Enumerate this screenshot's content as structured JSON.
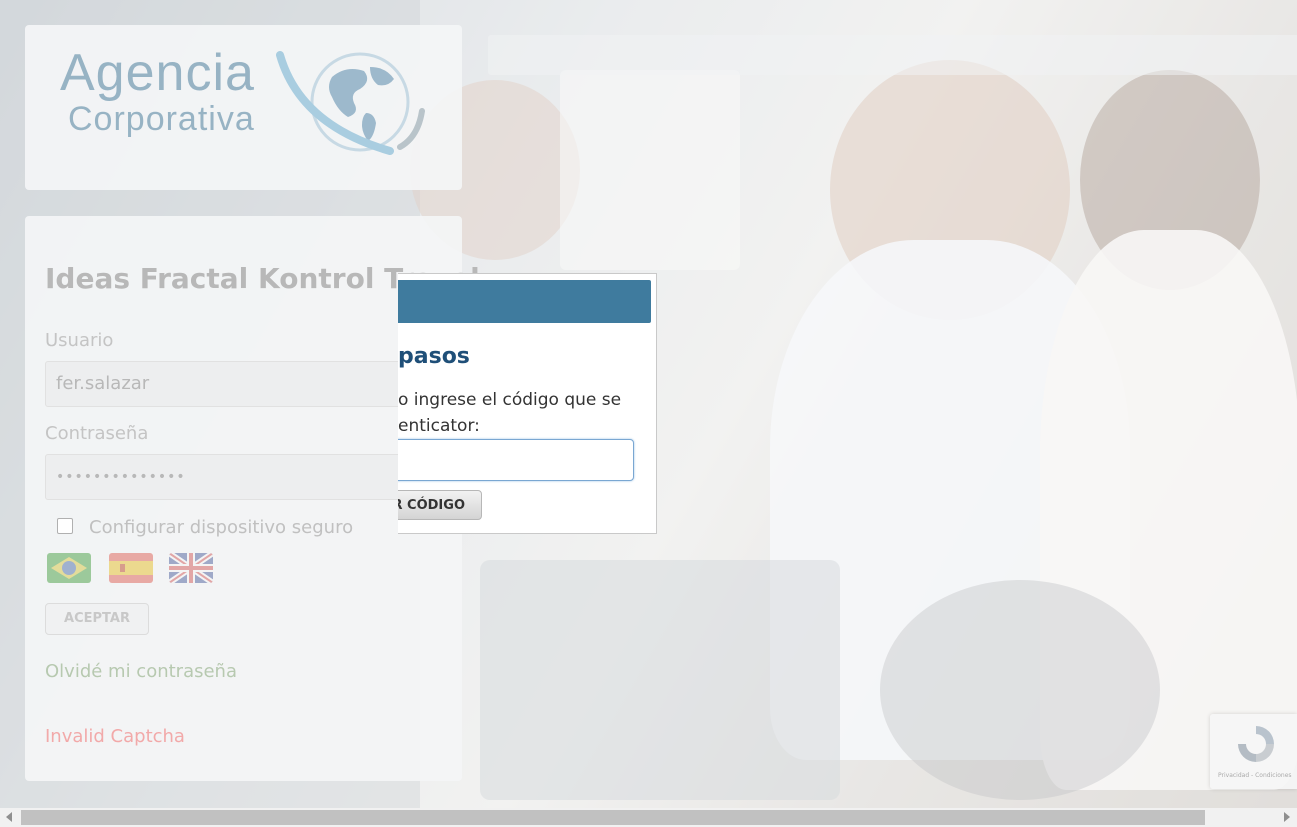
{
  "logo": {
    "line1": "Agencia",
    "line2": "Corporativa"
  },
  "login": {
    "title": "Ideas Fractal Kontrol Travel",
    "user_label": "Usuario",
    "user_value": "fer.salazar",
    "password_label": "Contraseña",
    "password_value": "••••••••••••••",
    "secure_device_label": "Configurar dispositivo seguro",
    "accept_label": "ACEPTAR",
    "forgot_label": "Olvidé mi contraseña",
    "captcha_error": "Invalid Captcha",
    "flags": [
      "brazil-flag-icon",
      "spain-flag-icon",
      "uk-flag-icon"
    ]
  },
  "modal": {
    "title": "pasos",
    "text_line1": "o ingrese el código que se",
    "text_line2": "enticator:",
    "code_value": "",
    "button_label": "R CÓDIGO",
    "header_color": "#3f7b9e"
  },
  "recaptcha": {
    "text": "Privacidad - Condiciones"
  }
}
